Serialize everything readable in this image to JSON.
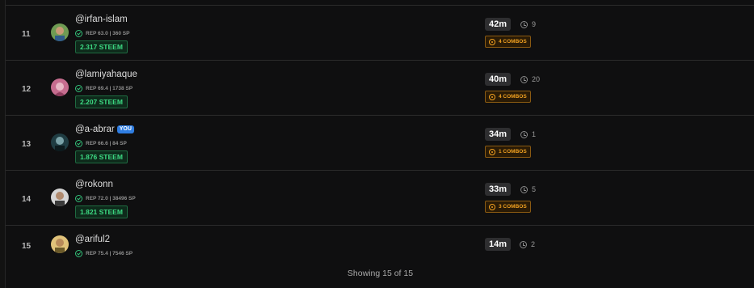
{
  "rows": [
    {
      "rank": "11",
      "username": "@irfan-islam",
      "rep": "REP 63.0 | 360 SP",
      "steem": "2.317 STEEM",
      "time": "42m",
      "count": "9",
      "combos": "4 COMBOS",
      "avatar_colors": [
        "#6f9b53",
        "#c89a76"
      ]
    },
    {
      "rank": "12",
      "username": "@lamiyahaque",
      "rep": "REP 69.4 | 1738 SP",
      "steem": "2.207 STEEM",
      "time": "40m",
      "count": "20",
      "combos": "4 COMBOS",
      "avatar_colors": [
        "#c66d8f",
        "#e7b8c5"
      ]
    },
    {
      "rank": "13",
      "username": "@a-abrar",
      "you": "YOU",
      "rep": "REP 66.6 | 84 SP",
      "steem": "1.876 STEEM",
      "time": "34m",
      "count": "1",
      "combos": "1 COMBOS",
      "avatar_colors": [
        "#1f3c42",
        "#7aa2a8"
      ]
    },
    {
      "rank": "14",
      "username": "@rokonn",
      "rep": "REP 72.0 | 38496 SP",
      "steem": "1.821 STEEM",
      "time": "33m",
      "count": "5",
      "combos": "3 COMBOS",
      "avatar_colors": [
        "#d5d5d5",
        "#3a3a3a"
      ]
    },
    {
      "rank": "15",
      "username": "@ariful2",
      "rep": "REP 75.4 | 7546 SP",
      "time": "14m",
      "count": "2",
      "avatar_colors": [
        "#e0c27a",
        "#6b5a2a"
      ]
    }
  ],
  "footer": "Showing 15 of 15"
}
